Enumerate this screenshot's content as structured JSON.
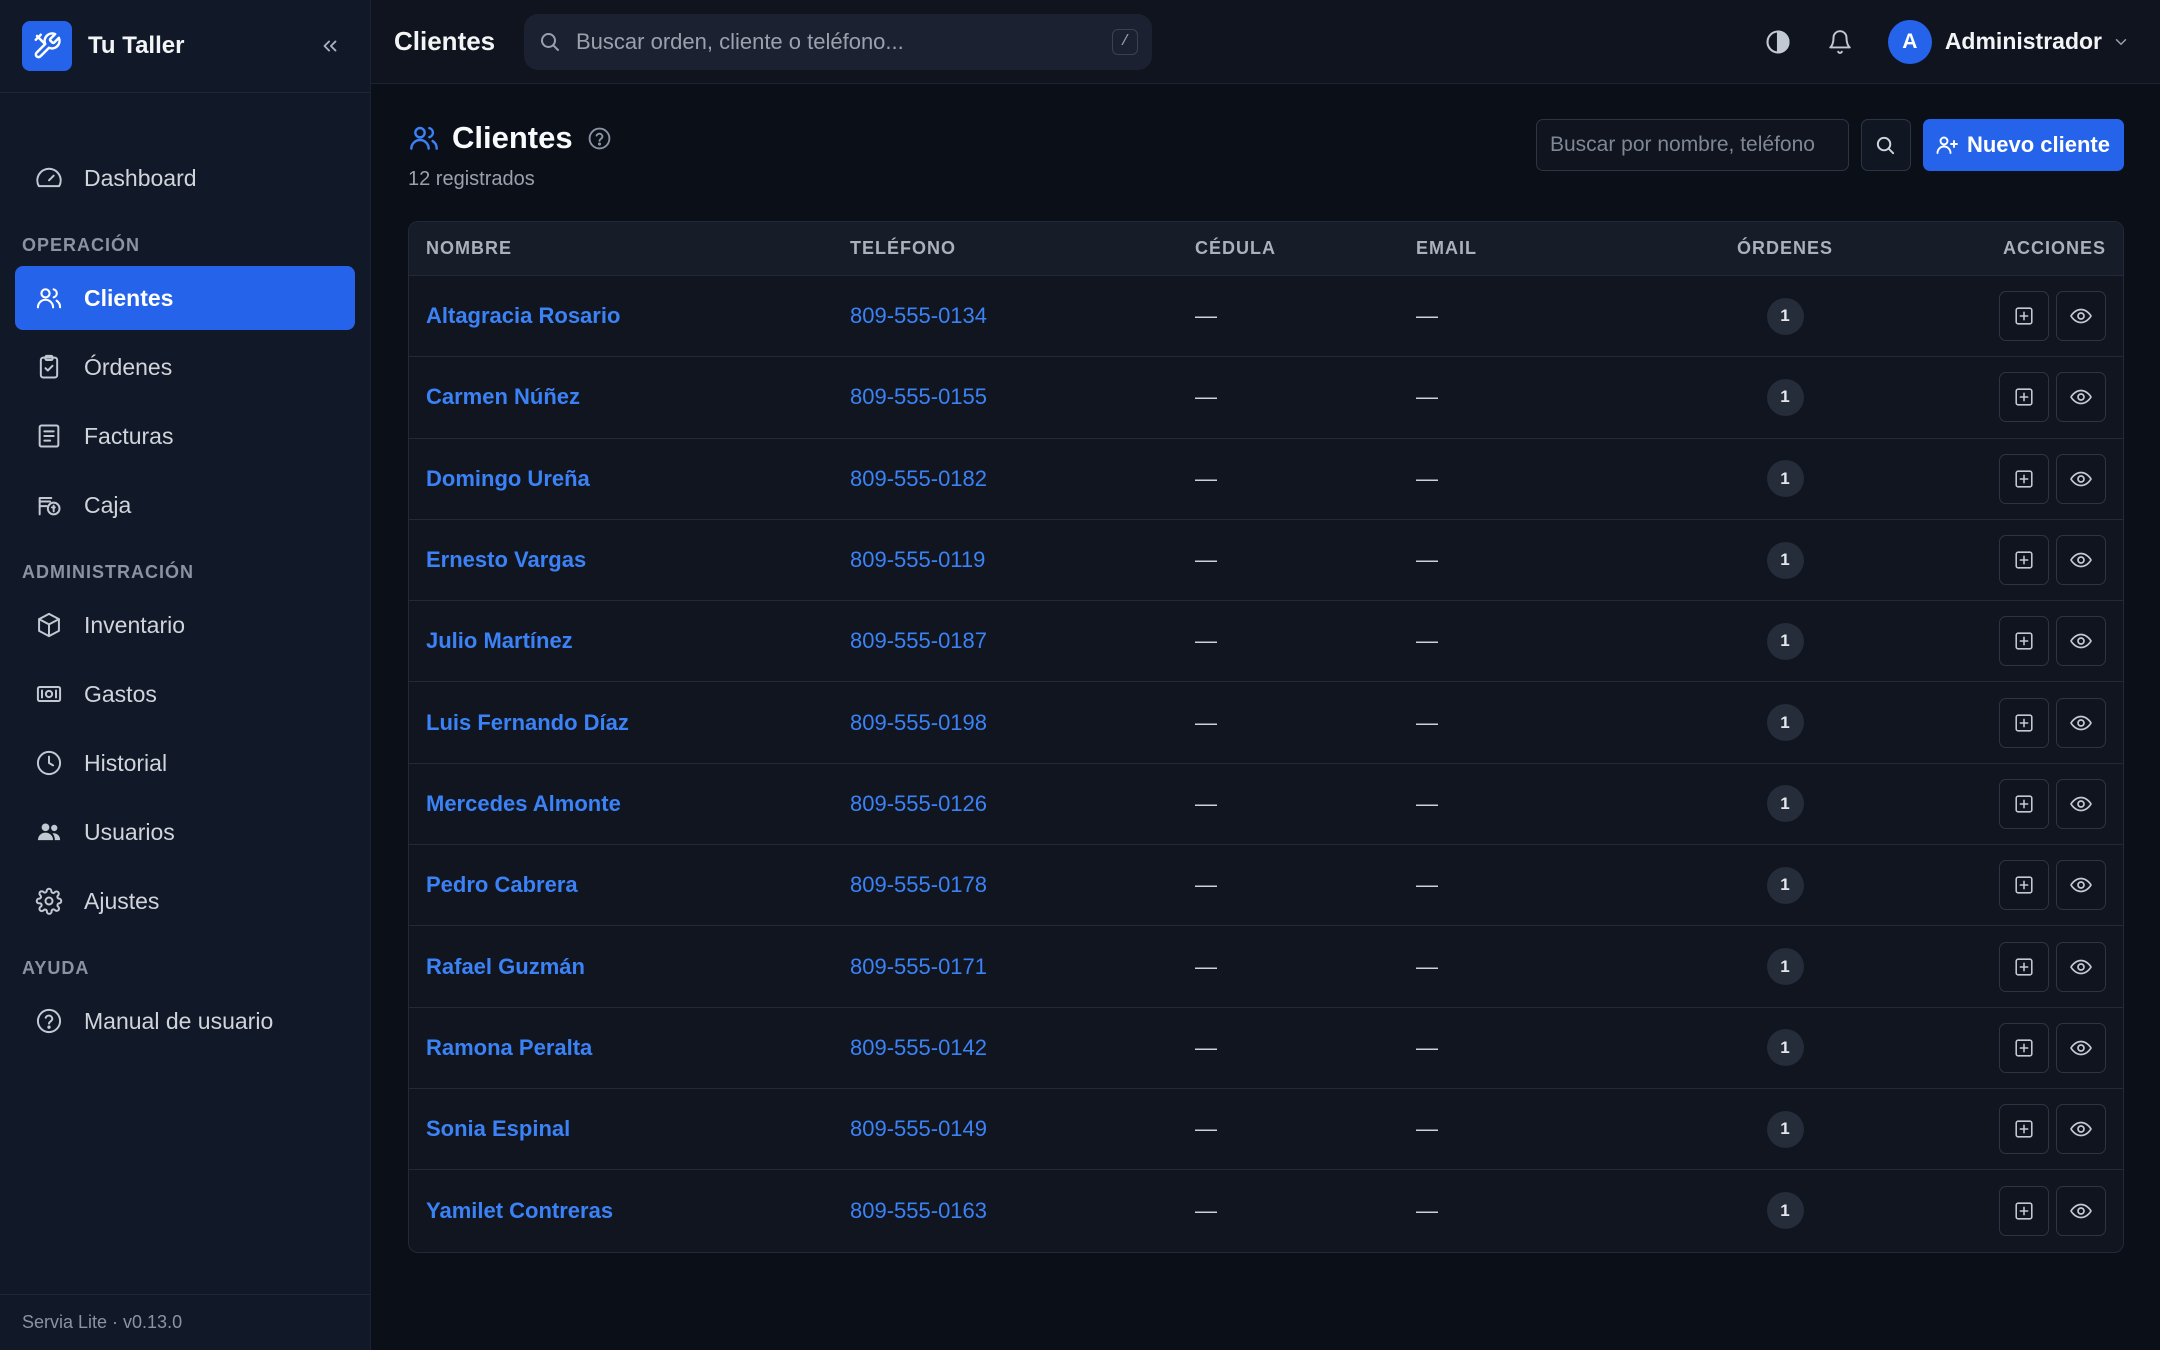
{
  "app": {
    "name": "Tu Taller",
    "version": "Servia Lite · v0.13.0"
  },
  "sidebar": {
    "top_items": [
      {
        "label": "Dashboard",
        "icon": "gauge-icon"
      }
    ],
    "sections": [
      {
        "title": "OPERACIÓN",
        "items": [
          {
            "label": "Clientes",
            "icon": "users-icon",
            "active": true
          },
          {
            "label": "Órdenes",
            "icon": "clipboard-icon"
          },
          {
            "label": "Facturas",
            "icon": "receipt-icon"
          },
          {
            "label": "Caja",
            "icon": "cash-register-icon"
          }
        ]
      },
      {
        "title": "ADMINISTRACIÓN",
        "items": [
          {
            "label": "Inventario",
            "icon": "box-icon"
          },
          {
            "label": "Gastos",
            "icon": "banknote-icon"
          },
          {
            "label": "Historial",
            "icon": "clock-icon"
          },
          {
            "label": "Usuarios",
            "icon": "user-group-icon"
          },
          {
            "label": "Ajustes",
            "icon": "gear-icon"
          }
        ]
      },
      {
        "title": "AYUDA",
        "items": [
          {
            "label": "Manual de usuario",
            "icon": "help-circle-icon"
          }
        ]
      }
    ]
  },
  "topbar": {
    "title": "Clientes",
    "search_placeholder": "Buscar orden, cliente o teléfono...",
    "search_shortcut": "/",
    "user_initial": "A",
    "user_name": "Administrador"
  },
  "page": {
    "title": "Clientes",
    "count_text": "12 registrados",
    "search_placeholder": "Buscar por nombre, teléfono",
    "new_button": "Nuevo cliente"
  },
  "table": {
    "columns": [
      "NOMBRE",
      "TELÉFONO",
      "CÉDULA",
      "EMAIL",
      "ÓRDENES",
      "ACCIONES"
    ],
    "rows": [
      {
        "name": "Altagracia Rosario",
        "phone": "809-555-0134",
        "cedula": "—",
        "email": "—",
        "orders": "1"
      },
      {
        "name": "Carmen Núñez",
        "phone": "809-555-0155",
        "cedula": "—",
        "email": "—",
        "orders": "1"
      },
      {
        "name": "Domingo Ureña",
        "phone": "809-555-0182",
        "cedula": "—",
        "email": "—",
        "orders": "1"
      },
      {
        "name": "Ernesto Vargas",
        "phone": "809-555-0119",
        "cedula": "—",
        "email": "—",
        "orders": "1"
      },
      {
        "name": "Julio Martínez",
        "phone": "809-555-0187",
        "cedula": "—",
        "email": "—",
        "orders": "1"
      },
      {
        "name": "Luis Fernando Díaz",
        "phone": "809-555-0198",
        "cedula": "—",
        "email": "—",
        "orders": "1"
      },
      {
        "name": "Mercedes Almonte",
        "phone": "809-555-0126",
        "cedula": "—",
        "email": "—",
        "orders": "1"
      },
      {
        "name": "Pedro Cabrera",
        "phone": "809-555-0178",
        "cedula": "—",
        "email": "—",
        "orders": "1"
      },
      {
        "name": "Rafael Guzmán",
        "phone": "809-555-0171",
        "cedula": "—",
        "email": "—",
        "orders": "1"
      },
      {
        "name": "Ramona Peralta",
        "phone": "809-555-0142",
        "cedula": "—",
        "email": "—",
        "orders": "1"
      },
      {
        "name": "Sonia Espinal",
        "phone": "809-555-0149",
        "cedula": "—",
        "email": "—",
        "orders": "1"
      },
      {
        "name": "Yamilet Contreras",
        "phone": "809-555-0163",
        "cedula": "—",
        "email": "—",
        "orders": "1"
      }
    ],
    "row_actions": [
      {
        "icon": "plus-square-icon"
      },
      {
        "icon": "eye-icon"
      }
    ]
  },
  "colors": {
    "accent": "#2563eb",
    "link": "#3b82f6",
    "background": "#0b0f17",
    "sidebar": "#111827"
  }
}
